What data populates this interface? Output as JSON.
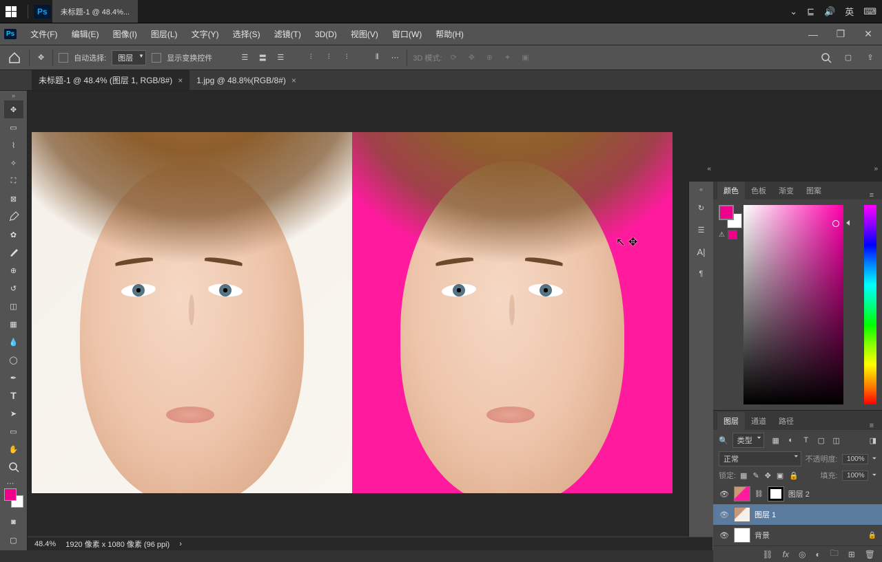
{
  "taskbar": {
    "title": "未标题-1 @ 48.4%...",
    "lang": "英"
  },
  "menubar": {
    "items": [
      "文件(F)",
      "编辑(E)",
      "图像(I)",
      "图层(L)",
      "文字(Y)",
      "选择(S)",
      "滤镜(T)",
      "3D(D)",
      "视图(V)",
      "窗口(W)",
      "帮助(H)"
    ]
  },
  "options": {
    "auto_select": "自动选择:",
    "layer_dd": "图层",
    "show_transform": "显示变换控件",
    "mode_3d": "3D 模式:"
  },
  "doc_tabs": [
    {
      "title": "未标题-1 @ 48.4% (图层 1, RGB/8#)",
      "active": true
    },
    {
      "title": "1.jpg @ 48.8%(RGB/8#)",
      "active": false
    }
  ],
  "color_panel": {
    "tabs": [
      "颜色",
      "色板",
      "渐变",
      "图案"
    ]
  },
  "layers_panel": {
    "tabs": [
      "图层",
      "通道",
      "路径"
    ],
    "type_dd": "类型",
    "blend_dd": "正常",
    "opacity_label": "不透明度:",
    "opacity_value": "100%",
    "lock_label": "锁定:",
    "fill_label": "填充:",
    "fill_value": "100%",
    "layers": [
      {
        "name": "图层 2",
        "active": false,
        "hasMask": true,
        "thumb": "face"
      },
      {
        "name": "图层 1",
        "active": true,
        "hasMask": false,
        "thumb": "face2"
      },
      {
        "name": "背景",
        "active": false,
        "hasMask": false,
        "thumb": "white",
        "locked": true
      }
    ]
  },
  "status": {
    "zoom": "48.4%",
    "dims": "1920 像素 x 1080 像素 (96 ppi)"
  }
}
